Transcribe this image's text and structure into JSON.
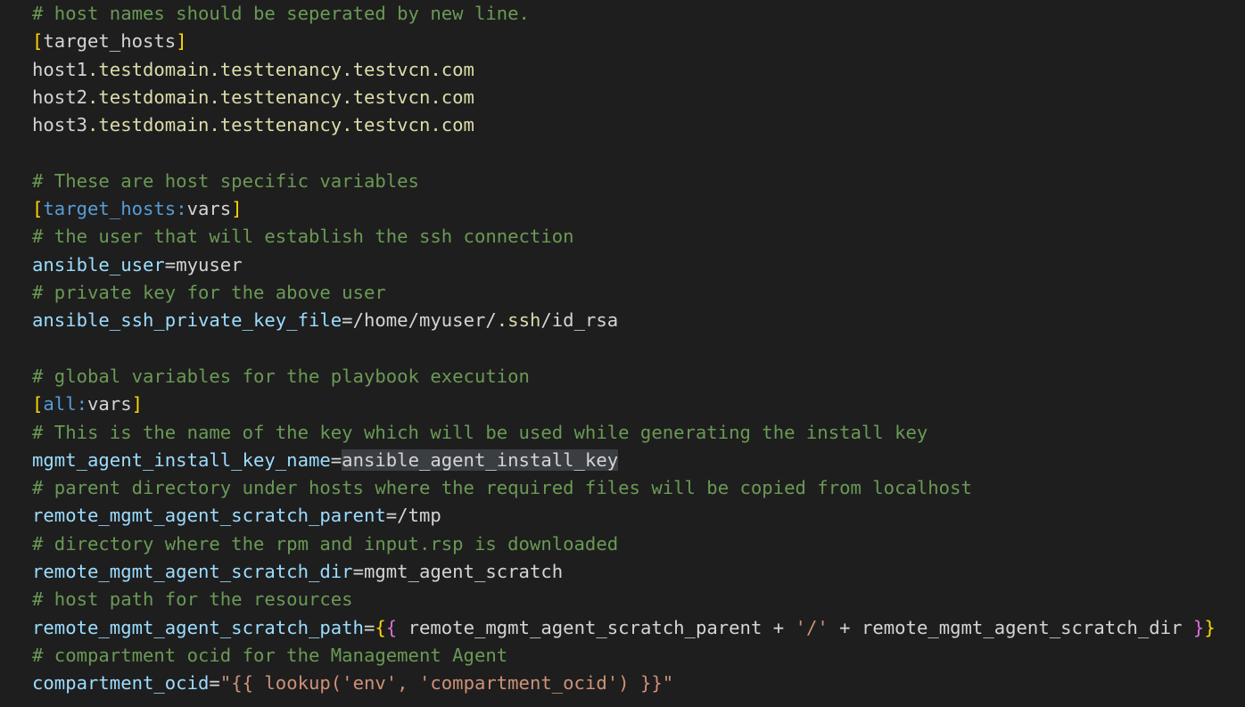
{
  "editor": {
    "lines": [
      {
        "tokens": [
          {
            "t": "# host names should be seperated by new line.",
            "c": "comment"
          }
        ]
      },
      {
        "tokens": [
          {
            "t": "[",
            "c": "bracket"
          },
          {
            "t": "target_hosts",
            "c": "section"
          },
          {
            "t": "]",
            "c": "bracket"
          }
        ]
      },
      {
        "tokens": [
          {
            "t": "host1",
            "c": "host"
          },
          {
            "t": ".testdomain.testtenancy.testvcn.com",
            "c": "host-dom"
          }
        ]
      },
      {
        "tokens": [
          {
            "t": "host2",
            "c": "host"
          },
          {
            "t": ".testdomain.testtenancy.testvcn.com",
            "c": "host-dom"
          }
        ]
      },
      {
        "tokens": [
          {
            "t": "host3",
            "c": "host"
          },
          {
            "t": ".testdomain.testtenancy.testvcn.com",
            "c": "host-dom"
          }
        ]
      },
      {
        "tokens": []
      },
      {
        "tokens": [
          {
            "t": "# These are host specific variables",
            "c": "comment"
          }
        ]
      },
      {
        "tokens": [
          {
            "t": "[",
            "c": "bracket"
          },
          {
            "t": "target_hosts:",
            "c": "section-ns"
          },
          {
            "t": "vars",
            "c": "section"
          },
          {
            "t": "]",
            "c": "bracket"
          }
        ]
      },
      {
        "tokens": [
          {
            "t": "# the user that will establish the ssh connection",
            "c": "comment"
          }
        ]
      },
      {
        "tokens": [
          {
            "t": "ansible_user",
            "c": "key"
          },
          {
            "t": "=",
            "c": "op"
          },
          {
            "t": "myuser",
            "c": "val"
          }
        ]
      },
      {
        "tokens": [
          {
            "t": "# private key for the above user",
            "c": "comment"
          }
        ]
      },
      {
        "tokens": [
          {
            "t": "ansible_ssh_private_key_file",
            "c": "key"
          },
          {
            "t": "=",
            "c": "op"
          },
          {
            "t": "/home/myuser/",
            "c": "val"
          },
          {
            "t": ".ssh",
            "c": "val-hl"
          },
          {
            "t": "/id_rsa",
            "c": "val"
          }
        ]
      },
      {
        "tokens": []
      },
      {
        "tokens": [
          {
            "t": "# global variables for the playbook execution",
            "c": "comment"
          }
        ]
      },
      {
        "tokens": [
          {
            "t": "[",
            "c": "bracket"
          },
          {
            "t": "all:",
            "c": "section-ns"
          },
          {
            "t": "vars",
            "c": "section"
          },
          {
            "t": "]",
            "c": "bracket"
          }
        ]
      },
      {
        "tokens": [
          {
            "t": "# This is the name of the key which will be used while generating the install key",
            "c": "comment"
          }
        ]
      },
      {
        "tokens": [
          {
            "t": "mgmt_agent_install_key_name",
            "c": "key"
          },
          {
            "t": "=",
            "c": "op"
          },
          {
            "t": "ansible_agent_install_key",
            "c": "select"
          }
        ]
      },
      {
        "tokens": [
          {
            "t": "# parent directory under hosts where the required files will be copied from localhost",
            "c": "comment"
          }
        ]
      },
      {
        "tokens": [
          {
            "t": "remote_mgmt_agent_scratch_parent",
            "c": "key"
          },
          {
            "t": "=",
            "c": "op"
          },
          {
            "t": "/tmp",
            "c": "val"
          }
        ]
      },
      {
        "tokens": [
          {
            "t": "# directory where the rpm and input.rsp is downloaded",
            "c": "comment"
          }
        ]
      },
      {
        "tokens": [
          {
            "t": "remote_mgmt_agent_scratch_dir",
            "c": "key"
          },
          {
            "t": "=",
            "c": "op"
          },
          {
            "t": "mgmt_agent_scratch",
            "c": "val"
          }
        ]
      },
      {
        "tokens": [
          {
            "t": "# host path for the resources",
            "c": "comment"
          }
        ]
      },
      {
        "tokens": [
          {
            "t": "remote_mgmt_agent_scratch_path",
            "c": "key"
          },
          {
            "t": "=",
            "c": "op"
          },
          {
            "t": "{",
            "c": "bracket"
          },
          {
            "t": "{",
            "c": "brace-p"
          },
          {
            "t": " remote_mgmt_agent_scratch_parent + ",
            "c": "val"
          },
          {
            "t": "'/'",
            "c": "string"
          },
          {
            "t": " + remote_mgmt_agent_scratch_dir ",
            "c": "val"
          },
          {
            "t": "}",
            "c": "brace-p"
          },
          {
            "t": "}",
            "c": "bracket"
          }
        ]
      },
      {
        "tokens": [
          {
            "t": "# compartment ocid for the Management Agent",
            "c": "comment"
          }
        ]
      },
      {
        "tokens": [
          {
            "t": "compartment_ocid",
            "c": "key"
          },
          {
            "t": "=",
            "c": "op"
          },
          {
            "t": "\"{{ lookup('env', 'compartment_ocid') }}\"",
            "c": "string"
          }
        ]
      }
    ]
  }
}
